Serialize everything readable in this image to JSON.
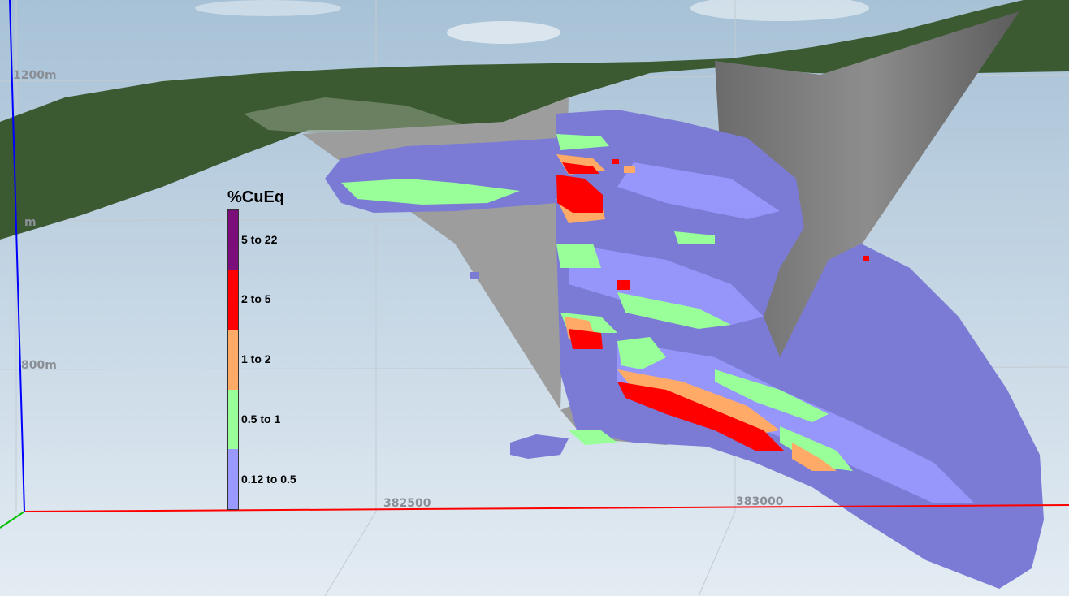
{
  "axes": {
    "elevation_labels": [
      "1200m",
      "m",
      "800m"
    ],
    "easting_labels": [
      "382500",
      "383000"
    ]
  },
  "legend": {
    "title": "%CuEq",
    "classes": [
      {
        "label": "5 to 22",
        "color": "#7b0e7b"
      },
      {
        "label": "2 to 5",
        "color": "#ff0000"
      },
      {
        "label": "1 to 2",
        "color": "#ffaa66"
      },
      {
        "label": "0.5 to 1",
        "color": "#99ff99"
      },
      {
        "label": "0.12 to 0.5",
        "color": "#9999ff"
      }
    ]
  },
  "colors": {
    "sky_top": "#a9c3d8",
    "sky_bottom": "#e2ebf2",
    "terrain": "#3b5a32",
    "pit_shell": "#8f8f8f",
    "block_low": "#7b7bd6",
    "axis_x": "#ff0000",
    "axis_y": "#0000ff",
    "axis_z": "#00c000"
  }
}
